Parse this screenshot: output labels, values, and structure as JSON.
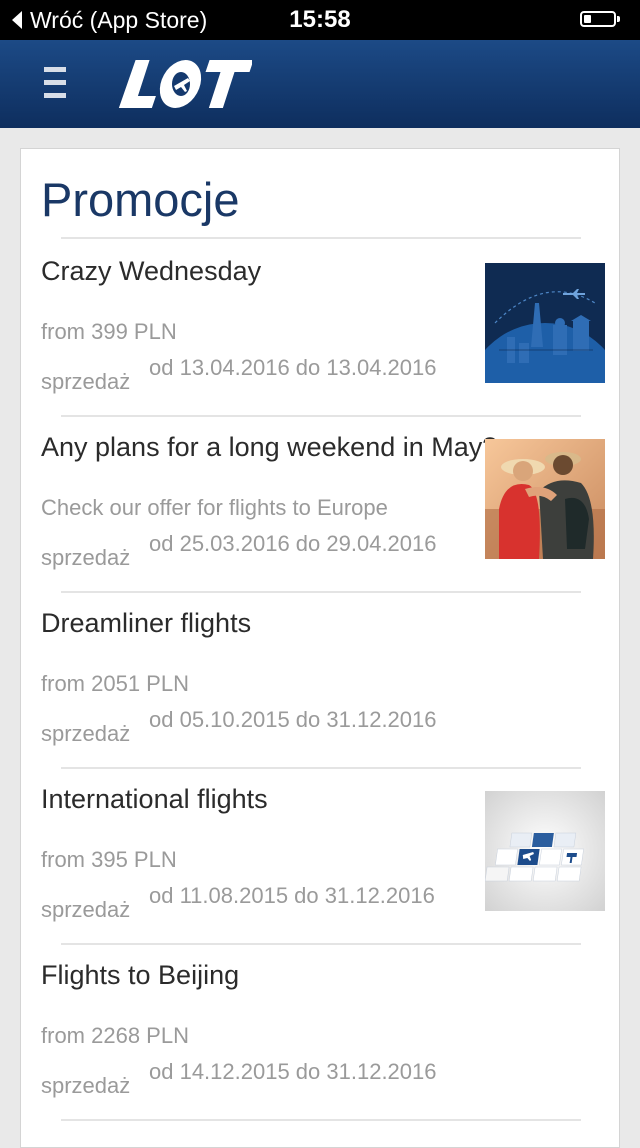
{
  "status_bar": {
    "back_label": "Wróć (App Store)",
    "time": "15:58"
  },
  "header": {
    "logo_text": "LOT",
    "menu_icon": "hamburger-menu-icon",
    "brand_color": "#16407a"
  },
  "page": {
    "title": "Promocje"
  },
  "sale_label": "sprzedaż",
  "promotions": [
    {
      "name": "Crazy Wednesday",
      "subtitle": "from 399 PLN",
      "dates": "od 13.04.2016 do 13.04.2016",
      "image": "travel-landmarks-image"
    },
    {
      "name": "Any plans for a long weekend in May?",
      "subtitle": "Check our offer for flights to Europe",
      "dates": "od 25.03.2016 do 29.04.2016",
      "image": "couple-travelers-image"
    },
    {
      "name": "Dreamliner flights",
      "subtitle": "from 2051 PLN",
      "dates": "od 05.10.2015 do 31.12.2016",
      "image": ""
    },
    {
      "name": "International flights",
      "subtitle": "from 395 PLN",
      "dates": "od 11.08.2015 do 31.12.2016",
      "image": "lot-cards-image"
    },
    {
      "name": "Flights to Beijing",
      "subtitle": "from 2268 PLN",
      "dates": "od 14.12.2015 do 31.12.2016",
      "image": ""
    }
  ]
}
